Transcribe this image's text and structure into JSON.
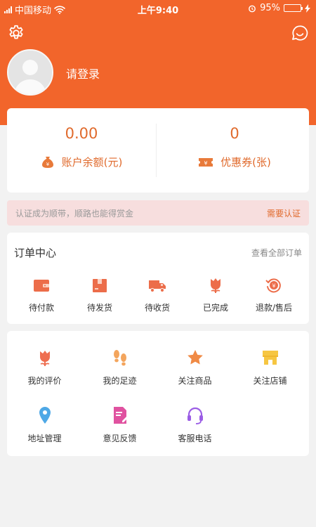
{
  "status_bar": {
    "carrier": "中国移动",
    "time": "上午9:40",
    "battery_percent": "95%",
    "battery_level": 0.95
  },
  "header": {
    "login_prompt": "请登录",
    "icons": {
      "settings": "gear-icon",
      "chat": "chat-bubble-icon",
      "avatar": "default-avatar"
    },
    "background_color": "#f2652b"
  },
  "balance": {
    "account_balance_value": "0.00",
    "account_balance_label": "账户余额(元)",
    "coupons_value": "0",
    "coupons_label": "优惠券(张)",
    "accent_color": "#e06a2c"
  },
  "notice": {
    "text": "认证成为顺带，顺路也能得赏金",
    "action_label": "需要认证"
  },
  "orders": {
    "title": "订单中心",
    "view_all_label": "查看全部订单",
    "items": [
      {
        "label": "待付款",
        "icon": "wallet-icon"
      },
      {
        "label": "待发货",
        "icon": "package-icon"
      },
      {
        "label": "待收货",
        "icon": "truck-icon"
      },
      {
        "label": "已完成",
        "icon": "flower-icon"
      },
      {
        "label": "退款/售后",
        "icon": "refund-icon"
      }
    ]
  },
  "tools": {
    "items": [
      {
        "label": "我的评价",
        "icon": "flower-icon"
      },
      {
        "label": "我的足迹",
        "icon": "footprints-icon"
      },
      {
        "label": "关注商品",
        "icon": "star-icon"
      },
      {
        "label": "关注店铺",
        "icon": "shop-icon"
      },
      {
        "label": "地址管理",
        "icon": "location-pin-icon"
      },
      {
        "label": "意见反馈",
        "icon": "feedback-icon"
      },
      {
        "label": "客服电话",
        "icon": "headset-icon"
      }
    ]
  }
}
